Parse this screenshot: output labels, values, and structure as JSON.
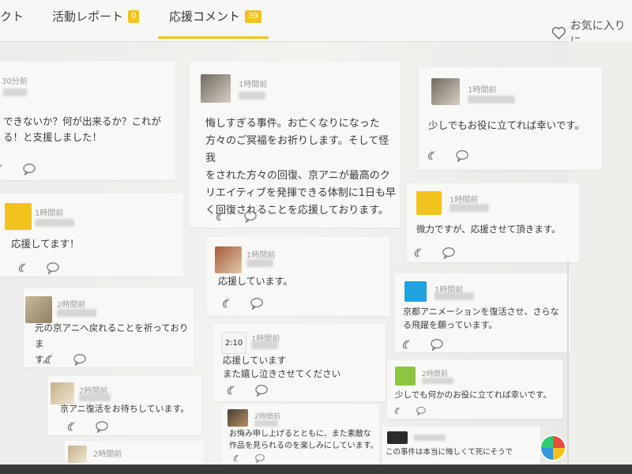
{
  "tabs": [
    {
      "label": "クト",
      "badge": ""
    },
    {
      "label": "活動レポート",
      "badge": "0"
    },
    {
      "label": "応援コメント",
      "badge": "39",
      "active": true
    }
  ],
  "favorite_label": "お気に入りに",
  "colors": {
    "accent": "#f2c31b"
  },
  "comments": [
    {
      "id": "c1",
      "time": "30分前",
      "body": "できないか？何が出来るか？これが\nる！と支援しました！"
    },
    {
      "id": "c2",
      "time": "1時間前",
      "body": "応援してます！"
    },
    {
      "id": "c3",
      "time": "2時間前",
      "body": "元の京アニへ戻れることを祈っておりま\nす。"
    },
    {
      "id": "c4",
      "time": "2時間前",
      "body": "京アニ復活をお待ちしています。"
    },
    {
      "id": "c5",
      "time": "2時間前",
      "body": ""
    },
    {
      "id": "c6",
      "time": "1時間前",
      "body": "悔しすぎる事件。お亡くなりになった\n方々のご冥福をお祈りします。そして怪我\nをされた方々の回復、京アニが最高のク\nリエイティブを発揮できる体制に1日も早\nく回復されることを応援しております。"
    },
    {
      "id": "c7",
      "time": "1時間前",
      "body": "応援しています。"
    },
    {
      "id": "c8",
      "time": "1時間前",
      "body": "応援しています\nまた嬉し泣きさせてください"
    },
    {
      "id": "c9",
      "time": "2時間前",
      "body": "お悔み申し上げるとともに、また素敵な\n作品を見られるのを楽しみにしています。"
    },
    {
      "id": "c10",
      "time": "1時間前",
      "body": "少しでもお役に立てれば幸いです。"
    },
    {
      "id": "c11",
      "time": "1時間前",
      "body": "微力ですが、応援させて頂きます。"
    },
    {
      "id": "c12",
      "time": "1時間前",
      "body": "京都アニメーションを復活させ、さらな\nる飛躍を願っています。"
    },
    {
      "id": "c13",
      "time": "2時間前",
      "body": "少しでも何かのお役に立てれば幸いです。"
    },
    {
      "id": "c14",
      "time": "",
      "body": "この事件は本当に悔しくて死にそうで"
    }
  ],
  "avatar_labels": {
    "c8": "2:10"
  },
  "icons": {
    "clap": "clap-icon",
    "comment": "comment-bubble-icon",
    "heart": "heart-outline-icon"
  }
}
